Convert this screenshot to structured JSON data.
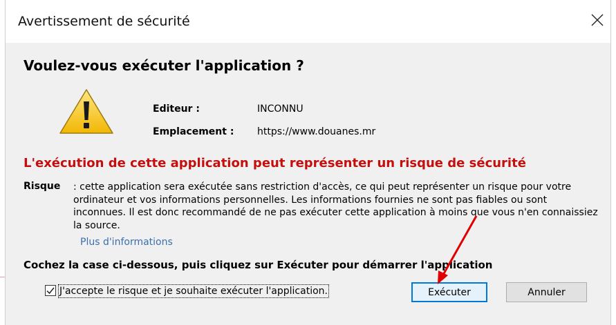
{
  "window": {
    "title": "Avertissement de sécurité"
  },
  "dialog": {
    "heading": "Voulez-vous exécuter l'application ?",
    "publisher_label": "Editeur :",
    "publisher_value": "INCONNU",
    "location_label": "Emplacement :",
    "location_value": "https://www.douanes.mr",
    "risk_heading": "L'exécution de cette application peut représenter un risque de sécurité",
    "risk_label": "Risque",
    "risk_text": ": cette application sera exécutée sans restriction d'accès, ce qui peut représenter un risque pour votre ordinateur et vos informations personnelles. Les informations fournies ne sont pas fiables ou sont inconnues. Il est donc recommandé de ne pas exécuter cette application à moins que vous n'en connaissiez la source.",
    "more_info_link": "Plus d'informations",
    "instruction": "Cochez la case ci-dessous, puis cliquez sur Exécuter pour démarrer l'application",
    "accept_checkbox_label": "J'accepte le risque et je souhaite exécuter l'application.",
    "accept_checked": true,
    "run_button": "Exécuter",
    "cancel_button": "Annuler"
  },
  "colors": {
    "risk_heading": "#c40f0f",
    "link": "#3a6fb0",
    "annotation_arrow": "#e00000",
    "default_button_border": "#0078d7"
  },
  "icons": {
    "warning": "warning-triangle-icon",
    "close": "close-icon",
    "checkmark": "checkmark-icon"
  }
}
